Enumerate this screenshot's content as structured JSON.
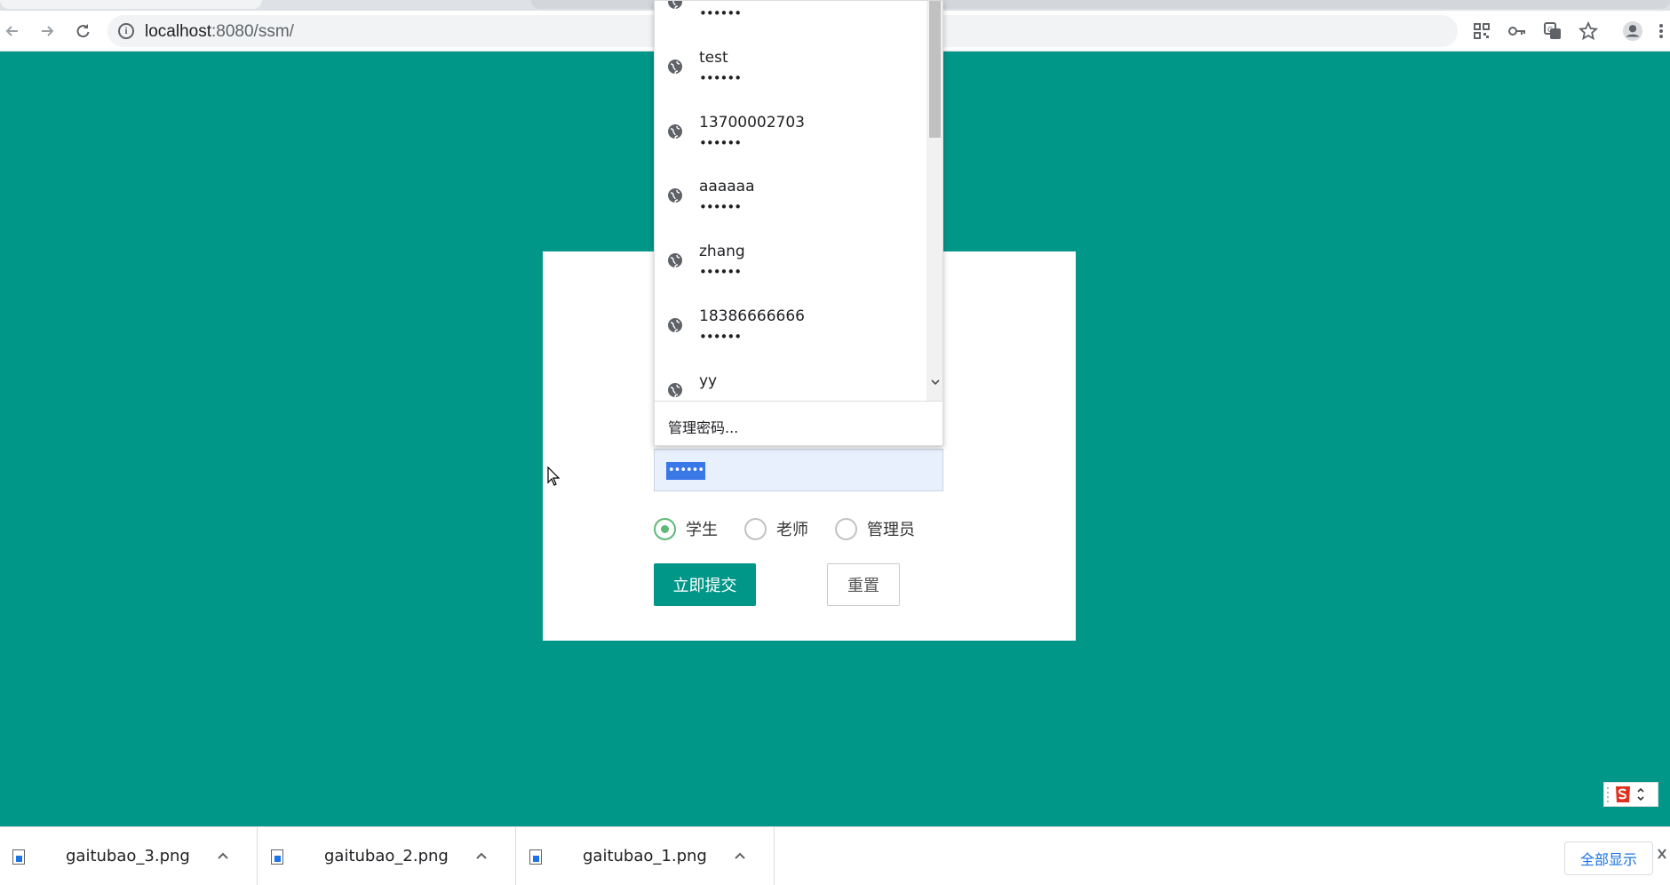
{
  "browser": {
    "url_host": "localhost",
    "url_rest": ":8080/ssm/",
    "icons": [
      "back-icon",
      "forward-icon",
      "reload-icon",
      "info-icon",
      "qr-icon",
      "key-icon",
      "translate-icon",
      "star-icon",
      "profile-icon",
      "menu-icon"
    ]
  },
  "autofill": {
    "entries": [
      {
        "user": "",
        "dots": "••••••"
      },
      {
        "user": "test",
        "dots": "••••••"
      },
      {
        "user": "13700002703",
        "dots": "••••••"
      },
      {
        "user": "aaaaaa",
        "dots": "••••••"
      },
      {
        "user": "zhang",
        "dots": "••••••"
      },
      {
        "user": "18386666666",
        "dots": "••••••"
      },
      {
        "user": "yy",
        "dots": ""
      }
    ],
    "manage_label": "管理密码..."
  },
  "form": {
    "password_value": "••••••",
    "roles": [
      {
        "label": "学生",
        "checked": true
      },
      {
        "label": "老师",
        "checked": false
      },
      {
        "label": "管理员",
        "checked": false
      }
    ],
    "submit_label": "立即提交",
    "reset_label": "重置"
  },
  "downloads": {
    "items": [
      {
        "name": "gaitubao_3.png"
      },
      {
        "name": "gaitubao_2.png"
      },
      {
        "name": "gaitubao_1.png"
      }
    ],
    "show_all_label": "全部显示"
  },
  "colors": {
    "page_bg": "#009688",
    "primary": "#009688",
    "radio_checked": "#5fb878",
    "autofill_bg": "#e8f0fe"
  }
}
